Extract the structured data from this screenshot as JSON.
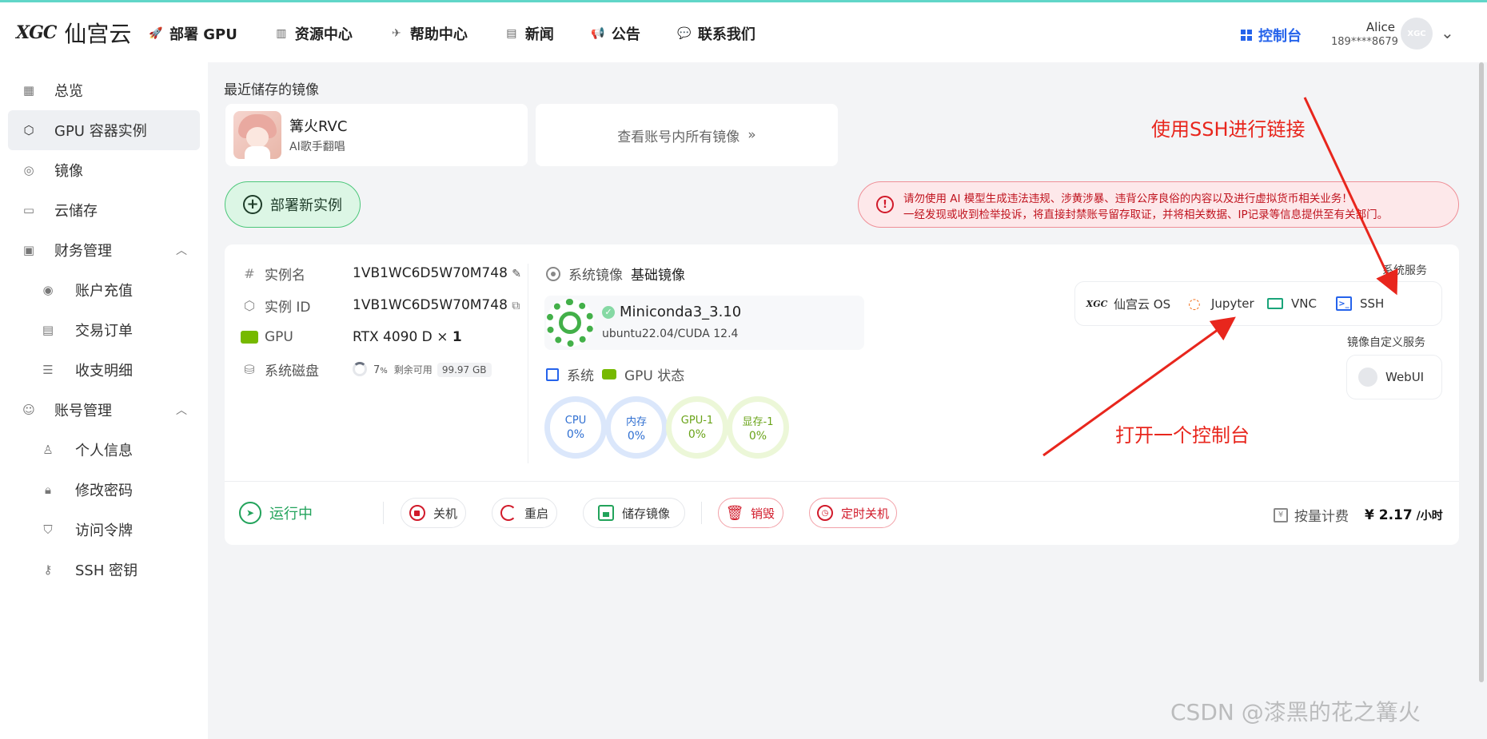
{
  "header": {
    "logo_mark": "XGC",
    "logo_text": "仙宫云",
    "nav": [
      "部署 GPU",
      "资源中心",
      "帮助中心",
      "新闻",
      "公告",
      "联系我们"
    ],
    "console": "控制台",
    "user_name": "Alice",
    "user_phone": "189****8679",
    "avatar_text": "XGC"
  },
  "sidebar": {
    "items": [
      "总览",
      "GPU 容器实例",
      "镜像",
      "云储存",
      "财务管理",
      "账户充值",
      "交易订单",
      "收支明细",
      "账号管理",
      "个人信息",
      "修改密码",
      "访问令牌",
      "SSH 密钥"
    ]
  },
  "recent": {
    "title": "最近储存的镜像",
    "name": "篝火RVC",
    "desc": "AI歌手翻唱",
    "view_all": "查看账号内所有镜像"
  },
  "deploy": {
    "label": "部署新实例"
  },
  "warning": {
    "line1": "请勿使用 AI 模型生成违法违规、涉黄涉暴、违背公序良俗的内容以及进行虚拟货币相关业务！",
    "line2": "一经发现或收到检举投诉，将直接封禁账号留存取证，并将相关数据、IP记录等信息提供至有关部门。"
  },
  "instance": {
    "name_key": "实例名",
    "name_val": "1VB1WC6D5W70M748",
    "id_key": "实例 ID",
    "id_val": "1VB1WC6D5W70M748",
    "gpu_key": "GPU",
    "gpu_val": "RTX 4090 D",
    "gpu_mult": "×",
    "gpu_count": "1",
    "disk_key": "系统磁盘",
    "disk_pct": "7",
    "disk_pct_unit": "%",
    "disk_free_label": "剩余可用",
    "disk_free": "99.97 GB",
    "sys_image_key": "系统镜像",
    "sys_image_val": "基础镜像",
    "image_name": "Miniconda3_3.10",
    "image_sub": "ubuntu22.04/CUDA 12.4",
    "status_sys": "系统",
    "status_gpu": "GPU 状态",
    "gauges": [
      {
        "label": "CPU",
        "value": "0%"
      },
      {
        "label": "内存",
        "value": "0%"
      },
      {
        "label": "GPU-1",
        "value": "0%"
      },
      {
        "label": "显存-1",
        "value": "0%"
      }
    ],
    "services_label": "系统服务",
    "services": [
      "仙宫云 OS",
      "Jupyter",
      "VNC",
      "SSH"
    ],
    "custom_label": "镜像自定义服务",
    "custom_service": "WebUI",
    "state": "运行中",
    "actions": [
      "关机",
      "重启",
      "储存镜像",
      "销毁",
      "定时关机"
    ],
    "billing_label": "按量计费",
    "price_symbol": "¥",
    "price": "2.17",
    "price_unit": "/小时"
  },
  "annotations": {
    "ssh": "使用SSH进行链接",
    "console": "打开一个控制台",
    "color": "#e8261d"
  },
  "watermark": "CSDN @漆黑的花之篝火"
}
